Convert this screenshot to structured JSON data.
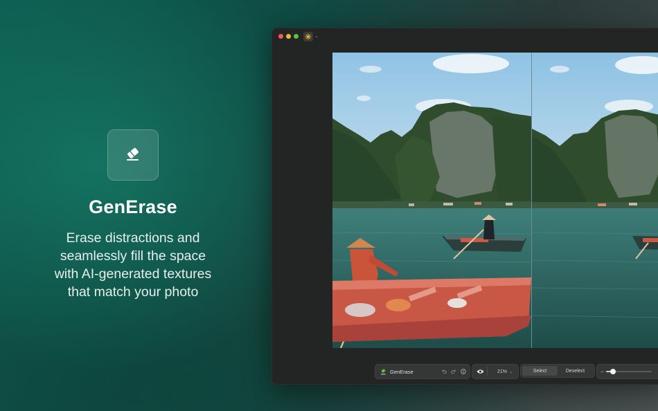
{
  "feature": {
    "icon": "eraser-icon",
    "title": "GenErase",
    "description_lines": [
      "Erase distractions and",
      "seamlessly fill the space",
      "with AI-generated textures",
      "that match your photo"
    ]
  },
  "window": {
    "app_logo_icon": "sparkle-icon",
    "accent_color": "#f0b429"
  },
  "canvas": {
    "left_photo_alt_state": "original",
    "right_photo_alt_state": "erased"
  },
  "toolbar": {
    "tool_name": "GenErase",
    "tool_icon": "generase-icon",
    "undo_icon": "undo-icon",
    "redo_icon": "redo-icon",
    "info_icon": "info-icon",
    "view_icon": "eye-icon",
    "zoom": "21%",
    "select_label": "Select",
    "deselect_label": "Deselect",
    "brush_size_value": "20",
    "brush_size_level": 0.15
  }
}
